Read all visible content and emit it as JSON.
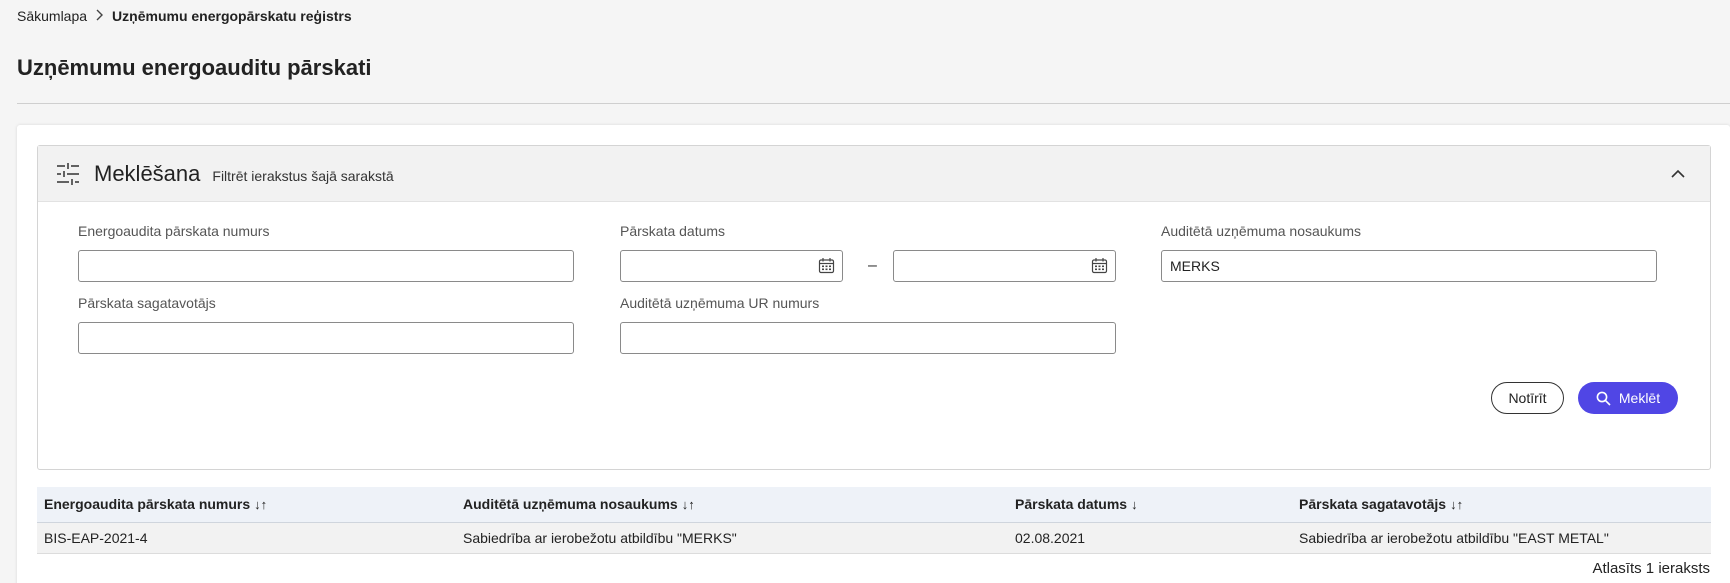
{
  "breadcrumb": {
    "home": "Sākumlapa",
    "separator": ">",
    "current": "Uzņēmumu energopārskatu reģistrs"
  },
  "page": {
    "title": "Uzņēmumu energoauditu pārskati"
  },
  "search": {
    "title": "Meklēšana",
    "subtitle": "Filtrēt ierakstus šajā sarakstā",
    "fields": {
      "report_number": {
        "label": "Energoaudita pārskata numurs",
        "value": ""
      },
      "report_date": {
        "label": "Pārskata datums",
        "from": "",
        "to": "",
        "range_separator": "–"
      },
      "company_name": {
        "label": "Auditētā uzņēmuma nosaukums",
        "value": "MERKS"
      },
      "preparer": {
        "label": "Pārskata sagatavotājs",
        "value": ""
      },
      "company_reg": {
        "label": "Auditētā uzņēmuma UR numurs",
        "value": ""
      }
    },
    "clear_label": "Notīrīt",
    "search_label": "Meklēt"
  },
  "table": {
    "columns": [
      {
        "label": "Energoaudita pārskata numurs",
        "sort": "↓↑"
      },
      {
        "label": "Auditētā uzņēmuma nosaukums",
        "sort": "↓↑"
      },
      {
        "label": "Pārskata datums",
        "sort": "↓"
      },
      {
        "label": "Pārskata sagatavotājs",
        "sort": "↓↑"
      }
    ],
    "rows": [
      [
        "BIS-EAP-2021-4",
        "Sabiedrība ar ierobežotu atbildību \"MERKS\"",
        "02.08.2021",
        "Sabiedrība ar ierobežotu atbildību \"EAST METAL\""
      ]
    ],
    "count": "Atlasīts 1 ieraksts"
  },
  "colors": {
    "primary": "#5046e5",
    "header_bg": "#eef2f8",
    "row_bg": "#f2f2f2"
  },
  "icons": {
    "filter": "sliders-icon",
    "collapse": "chevron-up-icon",
    "calendar": "calendar-icon",
    "search": "search-icon",
    "breadcrumb_sep": "chevron-right-icon"
  }
}
